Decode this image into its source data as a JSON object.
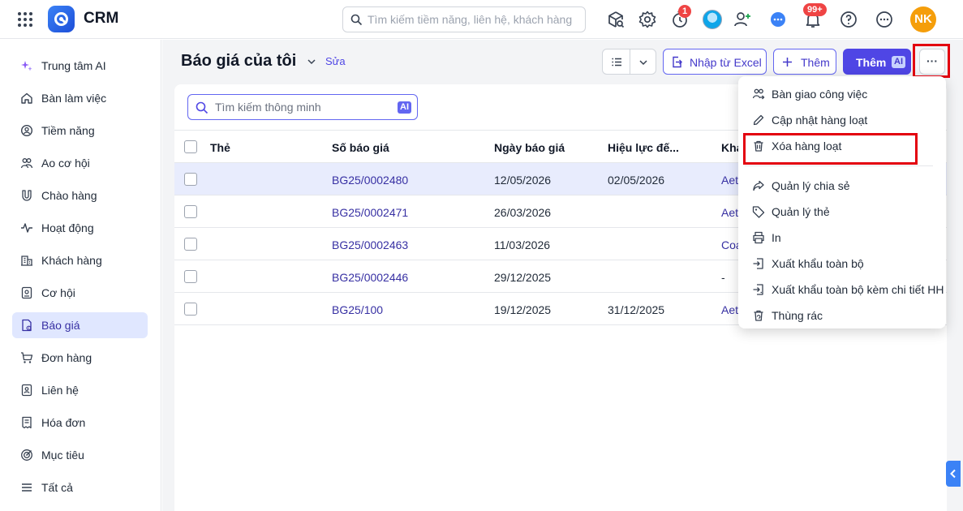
{
  "header": {
    "app_title": "CRM",
    "search_placeholder": "Tìm kiếm tiềm năng, liên hệ, khách hàng",
    "timer_badge": "1",
    "notification_badge": "99+",
    "user_initials": "NK"
  },
  "sidebar": {
    "items": [
      {
        "label": "Trung tâm AI",
        "icon": "sparkle-icon"
      },
      {
        "label": "Bàn làm việc",
        "icon": "home-icon"
      },
      {
        "label": "Tiềm năng",
        "icon": "lead-icon"
      },
      {
        "label": "Ao cơ hội",
        "icon": "pool-icon"
      },
      {
        "label": "Chào hàng",
        "icon": "magnet-icon"
      },
      {
        "label": "Hoạt động",
        "icon": "activity-icon"
      },
      {
        "label": "Khách hàng",
        "icon": "building-icon"
      },
      {
        "label": "Cơ hội",
        "icon": "opportunity-icon"
      },
      {
        "label": "Báo giá",
        "icon": "quote-icon",
        "active": true
      },
      {
        "label": "Đơn hàng",
        "icon": "cart-icon"
      },
      {
        "label": "Liên hệ",
        "icon": "contact-icon"
      },
      {
        "label": "Hóa đơn",
        "icon": "invoice-icon"
      },
      {
        "label": "Mục tiêu",
        "icon": "target-icon"
      },
      {
        "label": "Tất cả",
        "icon": "menu-icon"
      }
    ]
  },
  "page": {
    "title": "Báo giá của tôi",
    "edit_label": "Sửa",
    "import_label": "Nhập từ Excel",
    "add_label": "Thêm",
    "add_ai_label": "Thêm",
    "ai_tag": "AI",
    "more_label": "···"
  },
  "search": {
    "placeholder": "Tìm kiếm thông minh",
    "ai_chip": "AI"
  },
  "table": {
    "columns": [
      "Thẻ",
      "Số báo giá",
      "Ngày báo giá",
      "Hiệu lực đế...",
      "Kha"
    ],
    "rows": [
      {
        "number": "BG25/0002480",
        "date": "12/05/2026",
        "valid": "02/05/2026",
        "customer": "Aet",
        "selected": true
      },
      {
        "number": "BG25/0002471",
        "date": "26/03/2026",
        "valid": "",
        "customer": "Aet"
      },
      {
        "number": "BG25/0002463",
        "date": "11/03/2026",
        "valid": "",
        "customer": "Coa"
      },
      {
        "number": "BG25/0002446",
        "date": "29/12/2025",
        "valid": "",
        "customer": "-"
      },
      {
        "number": "BG25/100",
        "date": "19/12/2025",
        "valid": "31/12/2025",
        "customer": "Aet"
      }
    ]
  },
  "menu": {
    "items": [
      {
        "label": "Bàn giao công việc",
        "icon": "handover-icon"
      },
      {
        "label": "Cập nhật hàng loạt",
        "icon": "pencil-icon"
      },
      {
        "label": "Xóa hàng loạt",
        "icon": "trash-icon"
      },
      {
        "label": "Quản lý chia sẻ",
        "icon": "share-icon"
      },
      {
        "label": "Quản lý thẻ",
        "icon": "tag-icon"
      },
      {
        "label": "In",
        "icon": "printer-icon"
      },
      {
        "label": "Xuất khẩu toàn bộ",
        "icon": "export-icon"
      },
      {
        "label": "Xuất khẩu toàn bộ kèm chi tiết HH",
        "icon": "export-detail-icon"
      },
      {
        "label": "Thùng rác",
        "icon": "recycle-bin-icon"
      }
    ]
  },
  "colors": {
    "accent": "#4f46e5",
    "highlight": "#e3000f",
    "selected_row": "#e8ecfd",
    "active_nav": "#e0e7ff"
  }
}
